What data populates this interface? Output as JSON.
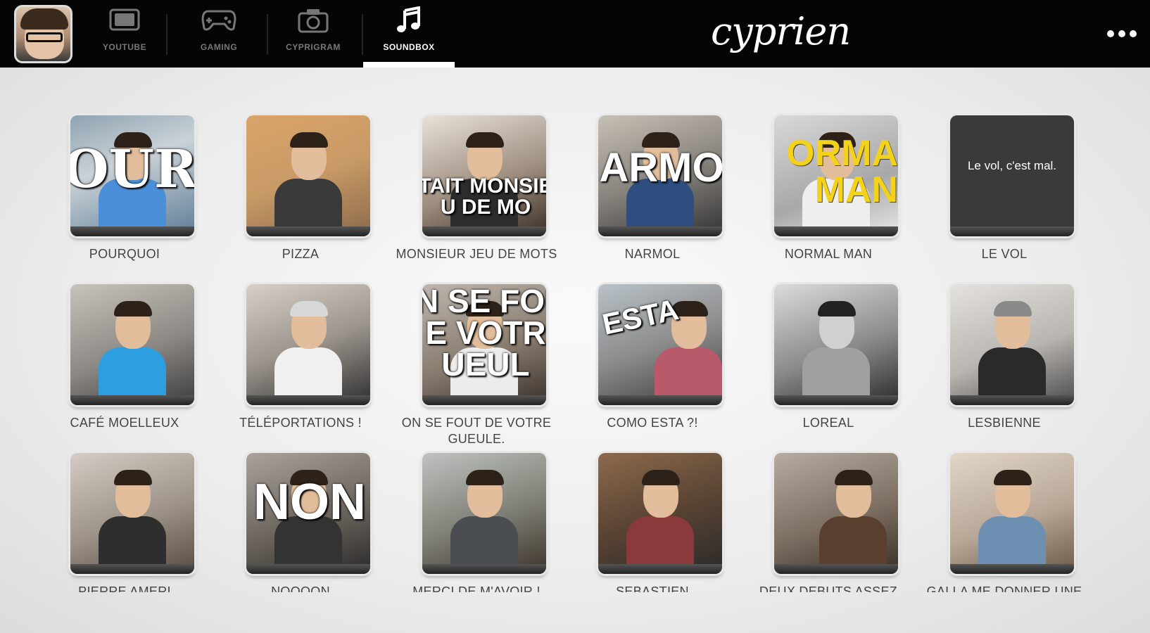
{
  "header": {
    "logo_text": "cyprien",
    "tabs": [
      {
        "label": "YOUTUBE",
        "icon": "tv-icon",
        "active": false
      },
      {
        "label": "GAMING",
        "icon": "gamepad-icon",
        "active": false
      },
      {
        "label": "CYPRIGRAM",
        "icon": "camera-icon",
        "active": false
      },
      {
        "label": "SOUNDBOX",
        "icon": "music-note-icon",
        "active": true
      }
    ],
    "menu_icon": "more-dots-icon"
  },
  "soundbox": {
    "sounds": [
      {
        "label": "POURQUOI",
        "overlay": "OURQUO"
      },
      {
        "label": "PIZZA",
        "overlay": ""
      },
      {
        "label": "MONSIEUR JEU DE MOTS",
        "overlay": "TAIT MONSIE\nU DE MO"
      },
      {
        "label": "NARMOL",
        "overlay": "ARMO"
      },
      {
        "label": "NORMAL MAN",
        "overlay": "ORMA\nMAN"
      },
      {
        "label": "LE VOL",
        "overlay": "Le vol, c'est mal."
      },
      {
        "label": "CAFÉ MOELLEUX",
        "overlay": ""
      },
      {
        "label": "TÉLÉPORTATIONS !",
        "overlay": ""
      },
      {
        "label": "ON SE FOUT DE VOTRE GUEULE.",
        "overlay": "N SE FOU\nE VOTR\nUEUL"
      },
      {
        "label": "COMO ESTA ?!",
        "overlay": "ESTA"
      },
      {
        "label": "LOREAL",
        "overlay": ""
      },
      {
        "label": "LESBIENNE",
        "overlay": ""
      },
      {
        "label": "PIERRE AMERI",
        "overlay": ""
      },
      {
        "label": "NOOOON",
        "overlay": "NON"
      },
      {
        "label": "MERCI DE M'AVOIR !",
        "overlay": ""
      },
      {
        "label": "SEBASTIEN",
        "overlay": ""
      },
      {
        "label": "DEUX DEBUTS ASSEZ",
        "overlay": ""
      },
      {
        "label": "GALLA ME DONNER UNE",
        "overlay": ""
      }
    ]
  }
}
